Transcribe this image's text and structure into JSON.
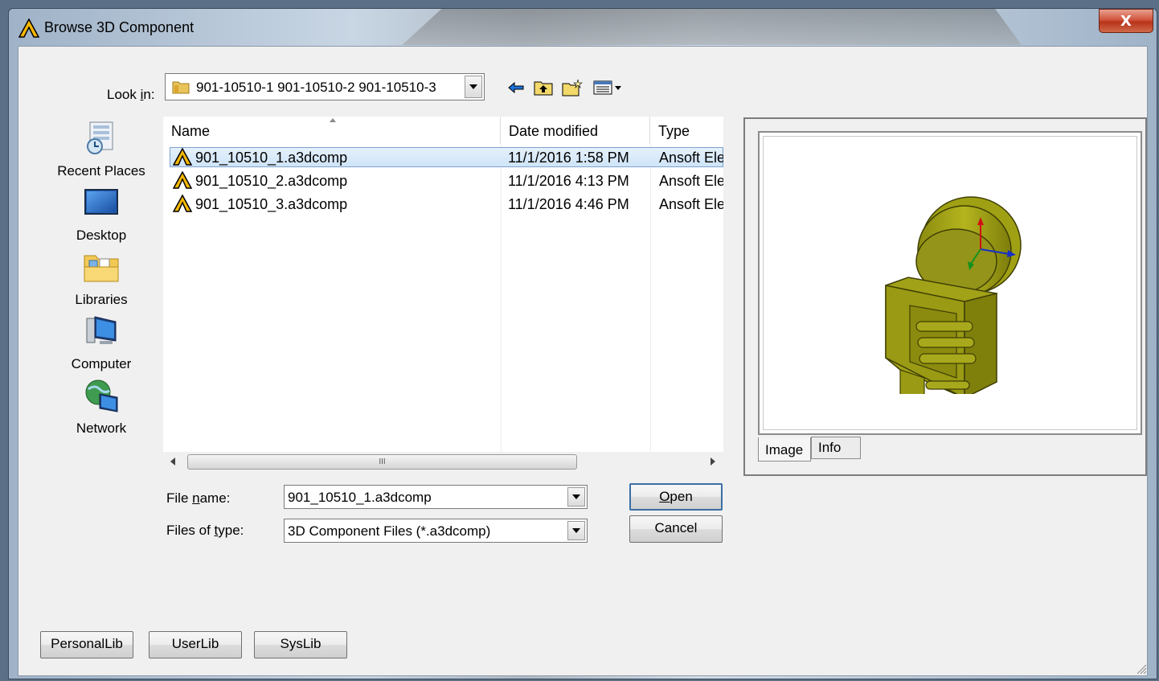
{
  "window": {
    "title": "Browse 3D Component",
    "close_glyph": "X"
  },
  "look_in": {
    "label_prefix": "Look ",
    "label_underlined": "i",
    "label_suffix": "n:",
    "value": "901-10510-1 901-10510-2 901-10510-3"
  },
  "toolbar": {
    "icons": [
      "back-arrow-icon",
      "up-folder-icon",
      "new-folder-icon",
      "view-menu-icon"
    ]
  },
  "places": [
    {
      "label": "Recent Places",
      "icon": "recent-places-icon"
    },
    {
      "label": "Desktop",
      "icon": "desktop-icon"
    },
    {
      "label": "Libraries",
      "icon": "libraries-icon"
    },
    {
      "label": "Computer",
      "icon": "computer-icon"
    },
    {
      "label": "Network",
      "icon": "network-icon"
    }
  ],
  "file_list": {
    "columns": [
      "Name",
      "Date modified",
      "Type"
    ],
    "rows": [
      {
        "name": "901_10510_1.a3dcomp",
        "date": "11/1/2016 1:58 PM",
        "type": "Ansoft Ele",
        "selected": true
      },
      {
        "name": "901_10510_2.a3dcomp",
        "date": "11/1/2016 4:13 PM",
        "type": "Ansoft Ele",
        "selected": false
      },
      {
        "name": "901_10510_3.a3dcomp",
        "date": "11/1/2016 4:46 PM",
        "type": "Ansoft Ele",
        "selected": false
      }
    ],
    "scroll_grip": "III"
  },
  "preview": {
    "tabs": [
      "Image",
      "Info"
    ],
    "active_tab": "Image",
    "model_color": "#9a9a14"
  },
  "file_name": {
    "label_prefix": "File ",
    "label_underlined": "n",
    "label_suffix": "ame:",
    "value": "901_10510_1.a3dcomp"
  },
  "file_type": {
    "label_prefix": "Files of ",
    "label_underlined": "t",
    "label_suffix": "ype:",
    "value": "3D Component Files (*.a3dcomp)"
  },
  "buttons": {
    "open_underlined": "O",
    "open_rest": "pen",
    "cancel": "Cancel",
    "personal_lib": "PersonalLib",
    "user_lib": "UserLib",
    "sys_lib": "SysLib"
  },
  "colors": {
    "selection": "#cfe4f8",
    "dialog_bg": "#f0f0f0",
    "logo_yellow": "#f5b800"
  }
}
